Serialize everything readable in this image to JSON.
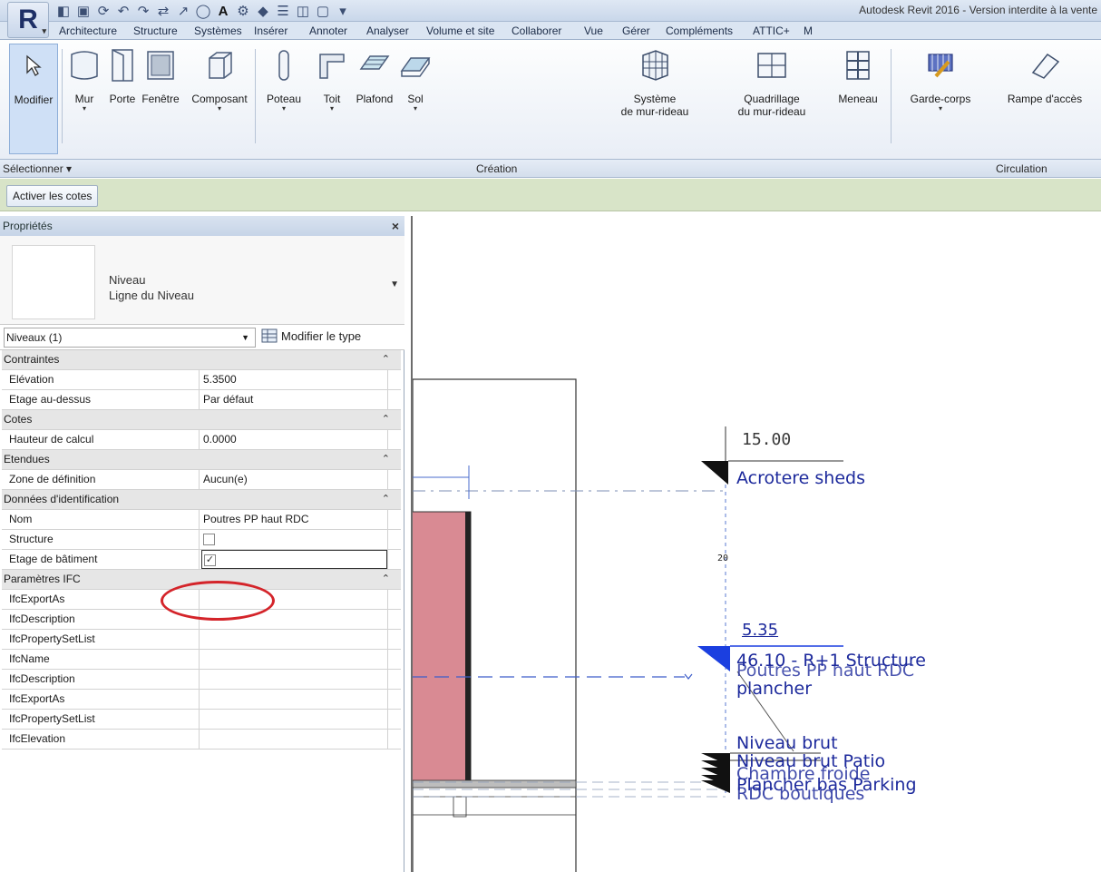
{
  "app": {
    "title": "Autodesk Revit 2016 - Version interdite à la vente",
    "logo": "R"
  },
  "tabs": [
    "Architecture",
    "Structure",
    "Systèmes",
    "Insérer",
    "Annoter",
    "Analyser",
    "Volume et site",
    "Collaborer",
    "Vue",
    "Gérer",
    "Compléments",
    "ATTIC+",
    "M"
  ],
  "ribbon": {
    "buttons": [
      {
        "label": "Modifier",
        "icon": "cursor-icon"
      },
      {
        "label": "Mur",
        "icon": "wall-icon",
        "dropdown": true
      },
      {
        "label": "Porte",
        "icon": "door-icon"
      },
      {
        "label": "Fenêtre",
        "icon": "window-icon"
      },
      {
        "label": "Composant",
        "icon": "component-icon",
        "dropdown": true
      },
      {
        "label": "Poteau",
        "icon": "column-icon",
        "dropdown": true
      },
      {
        "label": "Toit",
        "icon": "roof-icon",
        "dropdown": true
      },
      {
        "label": "Plafond",
        "icon": "ceiling-icon"
      },
      {
        "label": "Sol",
        "icon": "floor-icon",
        "dropdown": true
      },
      {
        "label": "Système\nde mur-rideau",
        "icon": "curtain-system-icon"
      },
      {
        "label": "Quadrillage\ndu mur-rideau",
        "icon": "curtain-grid-icon"
      },
      {
        "label": "Meneau",
        "icon": "mullion-icon"
      },
      {
        "label": "Garde-corps",
        "icon": "railing-icon",
        "dropdown": true
      },
      {
        "label": "Rampe d'accès",
        "icon": "ramp-icon"
      }
    ],
    "panels": {
      "select": "Sélectionner ▾",
      "create": "Création",
      "circulation": "Circulation"
    }
  },
  "options_bar": {
    "button": "Activer les cotes"
  },
  "properties": {
    "header": "Propriétés",
    "close": "×",
    "type_family": "Niveau",
    "type_name": "Ligne du Niveau",
    "filter": "Niveaux (1)",
    "edit_type": "Modifier le type",
    "rows": [
      {
        "section": true,
        "k": "Contraintes"
      },
      {
        "k": "Elévation",
        "v": "5.3500"
      },
      {
        "k": "Etage au-dessus",
        "v": "Par défaut"
      },
      {
        "section": true,
        "k": "Cotes"
      },
      {
        "k": "Hauteur de calcul",
        "v": "0.0000"
      },
      {
        "section": true,
        "k": "Etendues"
      },
      {
        "k": "Zone de définition",
        "v": "Aucun(e)"
      },
      {
        "section": true,
        "k": "Données d'identification"
      },
      {
        "k": "Nom",
        "v": "Poutres PP haut RDC"
      },
      {
        "k": "Structure",
        "checkbox": true,
        "checked": false
      },
      {
        "k": "Etage de bâtiment",
        "checkbox": true,
        "checked": true,
        "editing": true
      },
      {
        "section": true,
        "k": "Paramètres IFC"
      },
      {
        "k": "IfcExportAs",
        "v": ""
      },
      {
        "k": "IfcDescription",
        "v": ""
      },
      {
        "k": "IfcPropertySetList",
        "v": ""
      },
      {
        "k": "IfcName",
        "v": ""
      },
      {
        "k": "IfcDescription",
        "v": ""
      },
      {
        "k": "IfcExportAs",
        "v": ""
      },
      {
        "k": "IfcPropertySetList",
        "v": ""
      },
      {
        "k": "IfcElevation",
        "v": ""
      }
    ]
  },
  "view": {
    "elev_top": "15.00",
    "label_top": "Acrotere sheds",
    "small_dim": "20",
    "elev_mid": "5.35",
    "label_mid_a": "Poutres PP haut RDC",
    "label_mid_b": "46.10 - R+1 Structure",
    "label_mid_c": "plancher",
    "label_low_1": "Niveau brut",
    "label_low_2": "Niveau brut Patio",
    "label_low_3": "Plancher bas Parking",
    "label_low_4": "RDC boutiques",
    "label_low_5": "Chambre froide",
    "wall_color": "#d98a93",
    "annotation_color": "#1d2a9c"
  }
}
